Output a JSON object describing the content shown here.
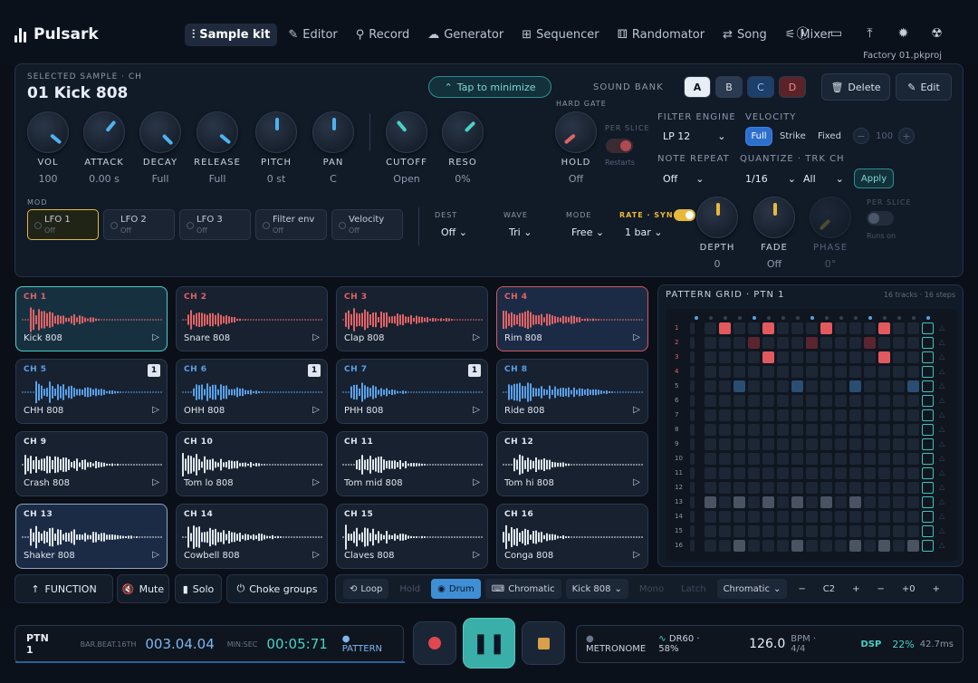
{
  "app": {
    "name": "Pulsark",
    "project": "Factory 01.pkproj"
  },
  "nav": [
    {
      "label": "Sample kit",
      "icon": "waveform-icon",
      "active": true
    },
    {
      "label": "Editor",
      "icon": "pencil-icon"
    },
    {
      "label": "Record",
      "icon": "mic-icon"
    },
    {
      "label": "Generator",
      "icon": "generator-icon"
    },
    {
      "label": "Sequencer",
      "icon": "grid-icon"
    },
    {
      "label": "Randomator",
      "icon": "dice-icon"
    },
    {
      "label": "Song",
      "icon": "loop-icon"
    },
    {
      "label": "Mixer",
      "icon": "sliders-icon"
    }
  ],
  "sample": {
    "caption": "SELECTED SAMPLE · CH",
    "name": "01 Kick 808",
    "minimize": "Tap to minimize",
    "sound_bank_label": "SOUND BANK",
    "banks": [
      "A",
      "B",
      "C",
      "D"
    ],
    "delete": "Delete",
    "edit": "Edit"
  },
  "knobs": [
    {
      "name": "VOL",
      "value": "100"
    },
    {
      "name": "ATTACK",
      "value": "0.00 s"
    },
    {
      "name": "DECAY",
      "value": "Full"
    },
    {
      "name": "RELEASE",
      "value": "Full"
    },
    {
      "name": "PITCH",
      "value": "0 st"
    },
    {
      "name": "PAN",
      "value": "C"
    },
    {
      "name": "CUTOFF",
      "value": "Open"
    },
    {
      "name": "RESO",
      "value": "0%"
    }
  ],
  "hold": {
    "title": "HARD GATE",
    "name": "HOLD",
    "value": "Off",
    "per_slice": "PER SLICE",
    "restarts": "Restarts"
  },
  "filter": {
    "label": "FILTER ENGINE",
    "value": "LP 12"
  },
  "velocity": {
    "label": "VELOCITY",
    "options": [
      "Full",
      "Strike",
      "Fixed"
    ],
    "minus": "−",
    "value": "100",
    "plus": "+"
  },
  "note_repeat": {
    "label": "NOTE REPEAT",
    "value": "Off"
  },
  "quantize": {
    "label": "QUANTIZE · TRK CH",
    "value": "1/16",
    "ch": "All",
    "apply": "Apply"
  },
  "mod": {
    "label": "MOD",
    "slots": [
      {
        "name": "LFO 1",
        "state": "Off"
      },
      {
        "name": "LFO 2",
        "state": "Off"
      },
      {
        "name": "LFO 3",
        "state": "Off"
      },
      {
        "name": "Filter env",
        "state": "Off"
      },
      {
        "name": "Velocity",
        "state": "Off"
      }
    ],
    "dest_label": "DEST",
    "dest": "Off",
    "wave_label": "WAVE",
    "wave": "Tri",
    "mode_label": "MODE",
    "mode": "Free",
    "rate_label": "RATE · SYNC",
    "rate": "1 bar",
    "depth": {
      "name": "DEPTH",
      "value": "0"
    },
    "fade": {
      "name": "FADE",
      "value": "Off"
    },
    "phase": {
      "name": "PHASE",
      "value": "0°"
    },
    "per_slice": "PER SLICE",
    "runs_on": "Runs on"
  },
  "channels": [
    {
      "ch": "CH 1",
      "name": "Kick 808",
      "color": "#e06466",
      "seed": 1
    },
    {
      "ch": "CH 2",
      "name": "Snare 808",
      "color": "#e06466",
      "seed": 2
    },
    {
      "ch": "CH 3",
      "name": "Clap 808",
      "color": "#e06466",
      "seed": 3
    },
    {
      "ch": "CH 4",
      "name": "Rim 808",
      "color": "#e06466",
      "seed": 4
    },
    {
      "ch": "CH 5",
      "name": "CHH 808",
      "color": "#5aa0e8",
      "badge": "1",
      "seed": 5
    },
    {
      "ch": "CH 6",
      "name": "OHH 808",
      "color": "#5aa0e8",
      "badge": "1",
      "seed": 6
    },
    {
      "ch": "CH 7",
      "name": "PHH 808",
      "color": "#5aa0e8",
      "badge": "1",
      "seed": 7
    },
    {
      "ch": "CH 8",
      "name": "Ride 808",
      "color": "#5aa0e8",
      "seed": 8
    },
    {
      "ch": "CH 9",
      "name": "Crash 808",
      "color": "#dfe6ef",
      "seed": 9
    },
    {
      "ch": "CH 10",
      "name": "Tom lo 808",
      "color": "#dfe6ef",
      "seed": 10
    },
    {
      "ch": "CH 11",
      "name": "Tom mid 808",
      "color": "#dfe6ef",
      "seed": 11
    },
    {
      "ch": "CH 12",
      "name": "Tom hi 808",
      "color": "#dfe6ef",
      "seed": 12
    },
    {
      "ch": "CH 13",
      "name": "Shaker 808",
      "color": "#dfe6ef",
      "seed": 13
    },
    {
      "ch": "CH 14",
      "name": "Cowbell 808",
      "color": "#dfe6ef",
      "seed": 14
    },
    {
      "ch": "CH 15",
      "name": "Claves 808",
      "color": "#dfe6ef",
      "seed": 15
    },
    {
      "ch": "CH 16",
      "name": "Conga 808",
      "color": "#dfe6ef",
      "seed": 16
    }
  ],
  "pattern": {
    "title": "PATTERN GRID · PTN 1",
    "info": "16 tracks · 16 steps",
    "rows": [
      "1",
      "2",
      "3",
      "4",
      "5",
      "6",
      "7",
      "8",
      "9",
      "10",
      "11",
      "12",
      "13",
      "14",
      "15",
      "16"
    ],
    "active": [
      [
        0,
        2
      ],
      [
        0,
        5
      ],
      [
        0,
        9
      ],
      [
        0,
        13
      ],
      [
        1,
        4
      ],
      [
        1,
        8
      ],
      [
        1,
        12
      ],
      [
        2,
        5
      ],
      [
        2,
        13
      ],
      [
        4,
        3
      ],
      [
        4,
        7
      ],
      [
        4,
        11
      ],
      [
        4,
        15
      ],
      [
        12,
        1
      ],
      [
        12,
        3
      ],
      [
        12,
        5
      ],
      [
        12,
        7
      ],
      [
        12,
        9
      ],
      [
        12,
        11
      ],
      [
        15,
        3
      ],
      [
        15,
        7
      ],
      [
        15,
        11
      ],
      [
        15,
        13
      ],
      [
        15,
        15
      ]
    ]
  },
  "footer": {
    "function": "FUNCTION",
    "mute": "Mute",
    "solo": "Solo",
    "choke": "Choke groups",
    "loop": "Loop",
    "hold": "Hold",
    "drum": "Drum",
    "chromatic": "Chromatic",
    "sample": "Kick 808",
    "mono": "Mono",
    "latch": "Latch",
    "scale": "Chromatic",
    "oct_minus": "−",
    "note": "C2",
    "oct_plus": "+",
    "tr_minus": "−",
    "transpose": "+0",
    "tr_plus": "+"
  },
  "transport": {
    "pattern": "PTN 1",
    "bbt_label": "BAR.BEAT.16TH",
    "bbt": "003.04.04",
    "time_label": "MIN:SEC",
    "time": "00:05:71",
    "mode": "PATTERN",
    "metronome": "METRONOME",
    "groove": "DR60 · 58%",
    "bpm": "126.0",
    "bpm_label": "BPM · 4/4",
    "dsp_label": "DSP",
    "dsp": "22%",
    "latency": "42.7ms"
  }
}
